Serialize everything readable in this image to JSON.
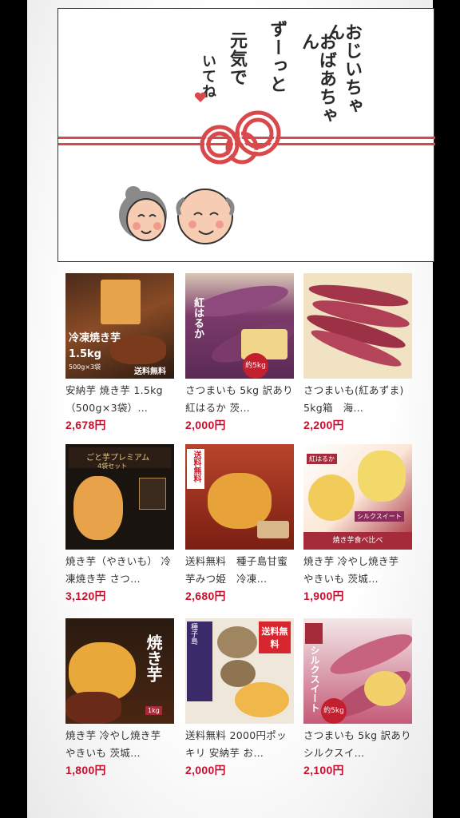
{
  "banner": {
    "message_lines": [
      "おじいちゃん",
      "おばあちゃん",
      "ずーっと",
      "元気で",
      "いてね"
    ],
    "accent_color": "#d9484a"
  },
  "products": [
    {
      "name": "安納芋 焼き芋 1.5kg（500g×3袋）…",
      "price": "2,678円",
      "img": {
        "t1": "冷凍焼き芋",
        "t2": "1.5kg",
        "t3": "500g×3袋",
        "t4": "送料無料"
      }
    },
    {
      "name": "さつまいも 5kg 訳あり 紅はるか 茨…",
      "price": "2,000円",
      "img": {
        "t1": "紅はるか",
        "t2": "約5kg"
      }
    },
    {
      "name": "さつまいも(紅あずま) 5kg箱　海…",
      "price": "2,200円",
      "img": {}
    },
    {
      "name": "焼き芋（やきいも） 冷凍焼き芋 さつ…",
      "price": "3,120円",
      "img": {
        "t1": "ごと芋プレミアム",
        "t2": "4袋セット"
      }
    },
    {
      "name": "送料無料　種子島甘蜜芋みつ姫　冷凍…",
      "price": "2,680円",
      "img": {
        "t1": "送料無料"
      }
    },
    {
      "name": "焼き芋 冷やし焼き芋 やきいも 茨城…",
      "price": "1,900円",
      "img": {
        "t1": "紅はるか",
        "t2": "シルクスイート",
        "t3": "焼き芋食べ比べ"
      }
    },
    {
      "name": "焼き芋 冷やし焼き芋 やきいも 茨城…",
      "price": "1,800円",
      "img": {
        "t1": "焼き芋",
        "t2": "1kg"
      }
    },
    {
      "name": "送料無料 2000円ポッキリ 安納芋 お…",
      "price": "2,000円",
      "img": {
        "t1": "送料無料",
        "t2": "種子島"
      }
    },
    {
      "name": "さつまいも 5kg 訳あり シルクスイ…",
      "price": "2,100円",
      "img": {
        "t1": "シルクスイート",
        "t2": "約5kg"
      }
    }
  ]
}
